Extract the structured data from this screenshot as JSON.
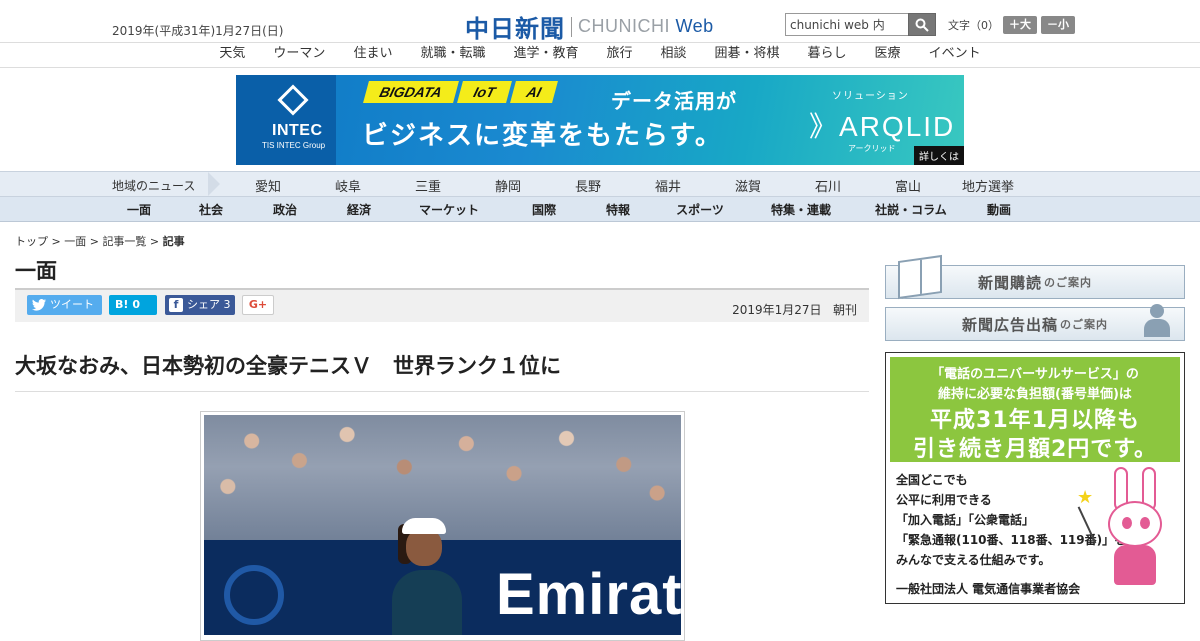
{
  "header": {
    "date": "2019年(平成31年)1月27日(日)",
    "logo_jp": "中日新聞",
    "logo_en_prefix": "CHUNICHI ",
    "logo_en_suffix": "Web",
    "search_value": "chunichi web 内",
    "font_label": "文字（0）",
    "font_larger": "＋大",
    "font_smaller": "－小"
  },
  "topnav": [
    "天気",
    "ウーマン",
    "住まい",
    "就職・転職",
    "進学・教育",
    "旅行",
    "相談",
    "囲碁・将棋",
    "暮らし",
    "医療",
    "イベント"
  ],
  "banner": {
    "brand": "INTEC",
    "brand_sub": "TIS INTEC Group",
    "tags": [
      "BIGDATA",
      "IoT",
      "AI"
    ],
    "copy1": "データ活用が",
    "copy2": "ビジネスに変革をもたらす。",
    "solution_label": "ソリューション",
    "product": "ARQLID",
    "product_kana": "アークリッド",
    "more": "詳しくは"
  },
  "region": {
    "title": "地域のニュース",
    "items": [
      "愛知",
      "岐阜",
      "三重",
      "静岡",
      "長野",
      "福井",
      "滋賀",
      "石川",
      "富山",
      "地方選挙"
    ]
  },
  "categories": [
    "一面",
    "社会",
    "政治",
    "経済",
    "マーケット",
    "国際",
    "特報",
    "スポーツ",
    "特集・連載",
    "社説・コラム",
    "動画"
  ],
  "breadcrumb": {
    "items": [
      "トップ",
      "一面",
      "記事一覧"
    ],
    "current": "記事",
    "sep": " > "
  },
  "section_title": "一面",
  "share": {
    "tweet": "ツイート",
    "hatena_count": "0",
    "fb_label": "シェア",
    "fb_count": "3",
    "gplus": "G+"
  },
  "article": {
    "date": "2019年1月27日",
    "edition": "朝刊",
    "headline": "大坂なおみ、日本勢初の全豪テニスＶ　世界ランク１位に",
    "photo_board_text": "Emirat"
  },
  "sidebar": {
    "subscribe_main": "新聞購読",
    "subscribe_sub": "のご案内",
    "ads_main": "新聞広告出稿",
    "ads_sub": "のご案内"
  },
  "ad": {
    "line1": "「電話のユニバーサルサービス」の",
    "line2": "維持に必要な負担額(番号単価)は",
    "line3": "平成31年1月以降も",
    "line4": "引き続き月額2円です。",
    "body1": "全国どこでも",
    "body2": "公平に利用できる",
    "body3": "「加入電話」「公衆電話」",
    "body4": "「緊急通報(110番、118番、119番)」を",
    "body5": "みんなで支える仕組みです。",
    "org": "一般社団法人 電気通信事業者協会"
  }
}
